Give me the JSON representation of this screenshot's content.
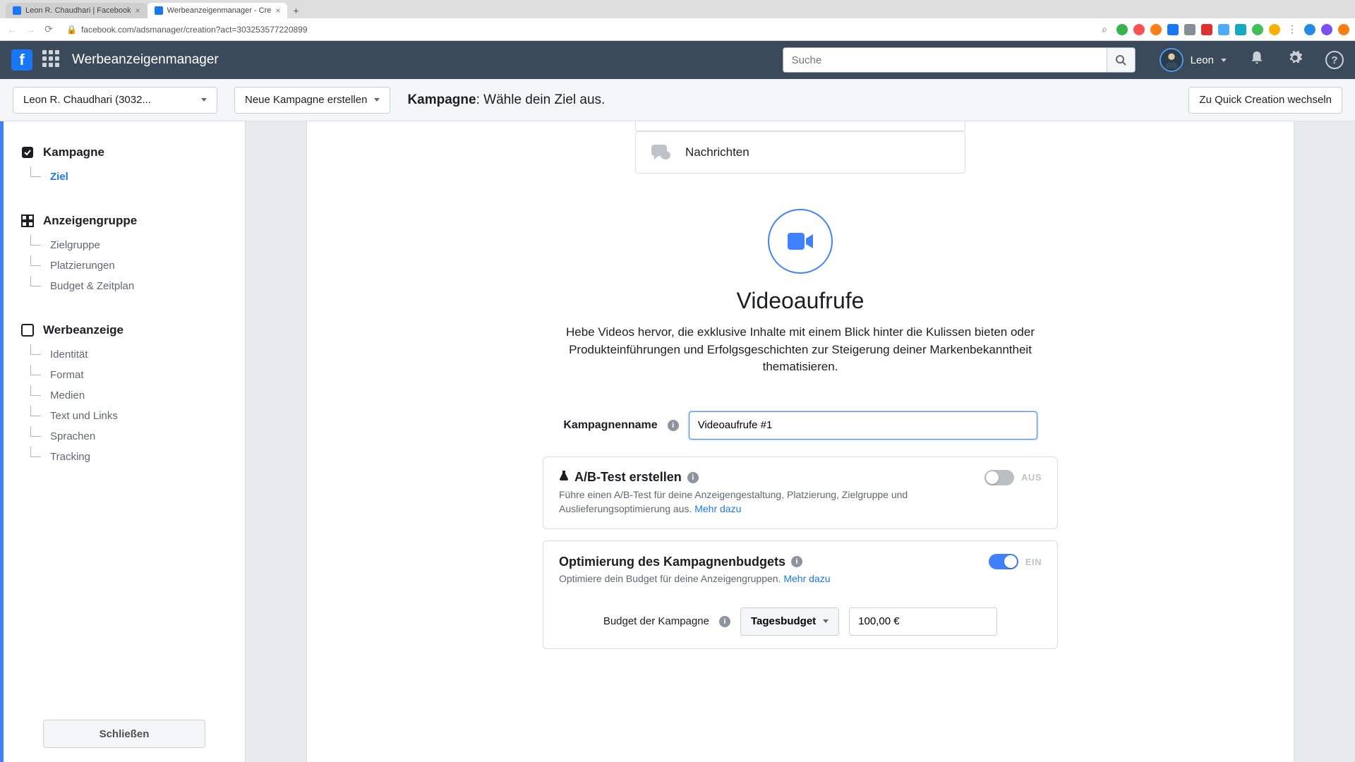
{
  "browser": {
    "tabs": [
      {
        "title": "Leon R. Chaudhari | Facebook",
        "active": false
      },
      {
        "title": "Werbeanzeigenmanager - Cre",
        "active": true
      }
    ],
    "url": "facebook.com/adsmanager/creation?act=303253577220899"
  },
  "topnav": {
    "app_title": "Werbeanzeigenmanager",
    "search_placeholder": "Suche",
    "user_name": "Leon"
  },
  "subheader": {
    "account_dd": "Leon R. Chaudhari (3032...",
    "create_dd": "Neue Kampagne erstellen",
    "title_bold": "Kampagne",
    "title_rest": ": Wähle dein Ziel aus.",
    "quick_create": "Zu Quick Creation wechseln"
  },
  "sidebar": {
    "sections": [
      {
        "title": "Kampagne",
        "items": [
          {
            "label": "Ziel",
            "active": true
          }
        ]
      },
      {
        "title": "Anzeigengruppe",
        "items": [
          {
            "label": "Zielgruppe"
          },
          {
            "label": "Platzierungen"
          },
          {
            "label": "Budget & Zeitplan"
          }
        ]
      },
      {
        "title": "Werbeanzeige",
        "items": [
          {
            "label": "Identität"
          },
          {
            "label": "Format"
          },
          {
            "label": "Medien"
          },
          {
            "label": "Text und Links"
          },
          {
            "label": "Sprachen"
          },
          {
            "label": "Tracking"
          }
        ]
      }
    ],
    "close": "Schließen"
  },
  "objective_tile": {
    "label": "Nachrichten"
  },
  "hero": {
    "title": "Videoaufrufe",
    "desc": "Hebe Videos hervor, die exklusive Inhalte mit einem Blick hinter die Kulissen bieten oder Produkteinführungen und Erfolgsgeschichten zur Steigerung deiner Markenbekanntheit thematisieren."
  },
  "campaign_name": {
    "label": "Kampagnenname",
    "value": "Videoaufrufe #1"
  },
  "abtest": {
    "title": "A/B-Test erstellen",
    "desc": "Führe einen A/B-Test für deine Anzeigengestaltung, Platzierung, Zielgruppe und Auslieferungsoptimierung aus. ",
    "more": "Mehr dazu",
    "state_label": "AUS"
  },
  "budget_opt": {
    "title": "Optimierung des Kampagnenbudgets",
    "desc": "Optimiere dein Budget für deine Anzeigengruppen. ",
    "more": "Mehr dazu",
    "state_label": "EIN"
  },
  "budget_row": {
    "label": "Budget der Kampagne",
    "type": "Tagesbudget",
    "amount": "100,00 €"
  }
}
